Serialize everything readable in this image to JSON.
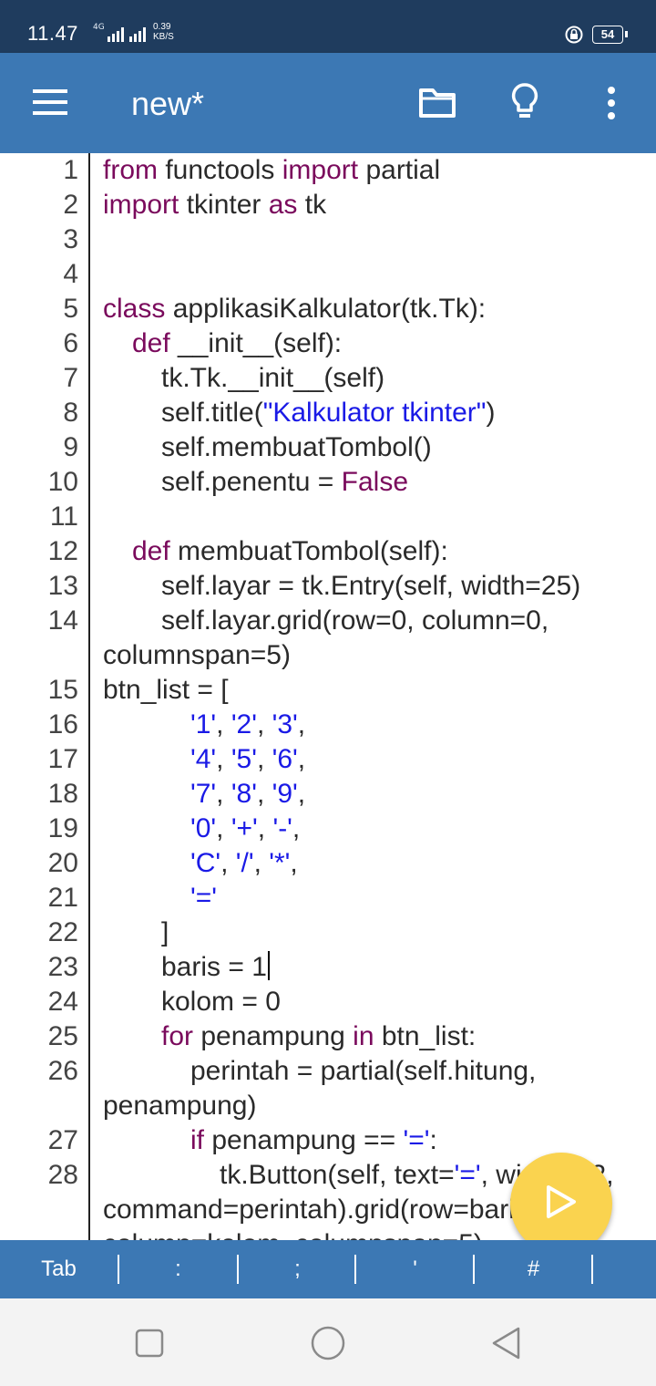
{
  "status_bar": {
    "time": "11.47",
    "network": "4G",
    "speed_value": "0.39",
    "speed_unit": "KB/S",
    "battery": "54"
  },
  "app_bar": {
    "title": "new*",
    "icons": [
      "menu-icon",
      "folder-icon",
      "lightbulb-icon",
      "more-vert-icon"
    ]
  },
  "editor": {
    "lines": [
      {
        "n": "1",
        "segs": [
          {
            "t": "from",
            "c": "kw"
          },
          {
            "t": " functools ",
            "c": ""
          },
          {
            "t": "import",
            "c": "kw"
          },
          {
            "t": " partial",
            "c": ""
          }
        ]
      },
      {
        "n": "2",
        "segs": [
          {
            "t": "import",
            "c": "kw"
          },
          {
            "t": " tkinter ",
            "c": ""
          },
          {
            "t": "as",
            "c": "kw"
          },
          {
            "t": " tk",
            "c": ""
          }
        ]
      },
      {
        "n": "3",
        "segs": []
      },
      {
        "n": "4",
        "segs": []
      },
      {
        "n": "5",
        "segs": [
          {
            "t": "class",
            "c": "kw"
          },
          {
            "t": " applikasiKalkulator(tk.Tk):",
            "c": ""
          }
        ]
      },
      {
        "n": "6",
        "indent": 1,
        "segs": [
          {
            "t": "def",
            "c": "kw"
          },
          {
            "t": " __init__(self):",
            "c": ""
          }
        ]
      },
      {
        "n": "7",
        "indent": 2,
        "segs": [
          {
            "t": "tk.Tk.__init__(self)",
            "c": ""
          }
        ]
      },
      {
        "n": "8",
        "indent": 2,
        "segs": [
          {
            "t": "self.title(",
            "c": ""
          },
          {
            "t": "\"Kalkulator tkinter\"",
            "c": "str"
          },
          {
            "t": ")",
            "c": ""
          }
        ]
      },
      {
        "n": "9",
        "indent": 2,
        "segs": [
          {
            "t": "self.membuatTombol()",
            "c": ""
          }
        ]
      },
      {
        "n": "10",
        "indent": 2,
        "segs": [
          {
            "t": "self.penentu = ",
            "c": ""
          },
          {
            "t": "False",
            "c": "kw"
          }
        ]
      },
      {
        "n": "11",
        "segs": []
      },
      {
        "n": "12",
        "indent": 1,
        "segs": [
          {
            "t": "def",
            "c": "kw"
          },
          {
            "t": " membuatTombol(self):",
            "c": ""
          }
        ]
      },
      {
        "n": "13",
        "indent": 2,
        "segs": [
          {
            "t": "self.layar = tk.Entry(self, width=25)",
            "c": ""
          }
        ]
      },
      {
        "n": "14",
        "indent": 2,
        "segs": [
          {
            "t": "self.layar.grid(row=0, column=0,",
            "c": ""
          }
        ]
      },
      {
        "n": "",
        "segs": [
          {
            "t": "columnspan=5)",
            "c": ""
          }
        ]
      },
      {
        "n": "15",
        "segs": [
          {
            "t": "btn_list = [",
            "c": ""
          }
        ]
      },
      {
        "n": "16",
        "indent": 3,
        "segs": [
          {
            "t": "'1'",
            "c": "str"
          },
          {
            "t": ", ",
            "c": ""
          },
          {
            "t": "'2'",
            "c": "str"
          },
          {
            "t": ", ",
            "c": ""
          },
          {
            "t": "'3'",
            "c": "str"
          },
          {
            "t": ",",
            "c": ""
          }
        ]
      },
      {
        "n": "17",
        "indent": 3,
        "segs": [
          {
            "t": "'4'",
            "c": "str"
          },
          {
            "t": ", ",
            "c": ""
          },
          {
            "t": "'5'",
            "c": "str"
          },
          {
            "t": ", ",
            "c": ""
          },
          {
            "t": "'6'",
            "c": "str"
          },
          {
            "t": ",",
            "c": ""
          }
        ]
      },
      {
        "n": "18",
        "indent": 3,
        "segs": [
          {
            "t": "'7'",
            "c": "str"
          },
          {
            "t": ", ",
            "c": ""
          },
          {
            "t": "'8'",
            "c": "str"
          },
          {
            "t": ", ",
            "c": ""
          },
          {
            "t": "'9'",
            "c": "str"
          },
          {
            "t": ",",
            "c": ""
          }
        ]
      },
      {
        "n": "19",
        "indent": 3,
        "segs": [
          {
            "t": "'0'",
            "c": "str"
          },
          {
            "t": ", ",
            "c": ""
          },
          {
            "t": "'+'",
            "c": "str"
          },
          {
            "t": ", ",
            "c": ""
          },
          {
            "t": "'-'",
            "c": "str"
          },
          {
            "t": ",",
            "c": ""
          }
        ]
      },
      {
        "n": "20",
        "indent": 3,
        "segs": [
          {
            "t": "'C'",
            "c": "str"
          },
          {
            "t": ", ",
            "c": ""
          },
          {
            "t": "'/'",
            "c": "str"
          },
          {
            "t": ", ",
            "c": ""
          },
          {
            "t": "'*'",
            "c": "str"
          },
          {
            "t": ",",
            "c": ""
          }
        ]
      },
      {
        "n": "21",
        "indent": 3,
        "segs": [
          {
            "t": "'='",
            "c": "str"
          }
        ]
      },
      {
        "n": "22",
        "indent": 2,
        "segs": [
          {
            "t": "]",
            "c": ""
          }
        ]
      },
      {
        "n": "23",
        "indent": 2,
        "cursor": true,
        "segs": [
          {
            "t": "baris = 1",
            "c": ""
          }
        ]
      },
      {
        "n": "24",
        "indent": 2,
        "segs": [
          {
            "t": "kolom = 0",
            "c": ""
          }
        ]
      },
      {
        "n": "25",
        "indent": 2,
        "segs": [
          {
            "t": "for",
            "c": "kw"
          },
          {
            "t": " penampung ",
            "c": ""
          },
          {
            "t": "in",
            "c": "kw"
          },
          {
            "t": " btn_list:",
            "c": ""
          }
        ]
      },
      {
        "n": "26",
        "indent": 3,
        "segs": [
          {
            "t": "perintah = partial(self.hitung,",
            "c": ""
          }
        ]
      },
      {
        "n": "",
        "segs": [
          {
            "t": "penampung)",
            "c": ""
          }
        ]
      },
      {
        "n": "27",
        "indent": 3,
        "segs": [
          {
            "t": "if",
            "c": "kw"
          },
          {
            "t": " penampung == ",
            "c": ""
          },
          {
            "t": "'='",
            "c": "str"
          },
          {
            "t": ":",
            "c": ""
          }
        ]
      },
      {
        "n": "28",
        "indent": 4,
        "segs": [
          {
            "t": "tk.Button(self, text=",
            "c": ""
          },
          {
            "t": "'='",
            "c": "str"
          },
          {
            "t": ", width=22,",
            "c": ""
          }
        ]
      },
      {
        "n": "",
        "segs": [
          {
            "t": "command=perintah).grid(row=baris,",
            "c": ""
          }
        ]
      },
      {
        "n": "",
        "segs": [
          {
            "t": "column=kolom, columnspan=5)",
            "c": ""
          }
        ]
      }
    ]
  },
  "run_button": {
    "icon": "play-icon"
  },
  "key_bar": {
    "keys": [
      "Tab",
      ":",
      ";",
      "'",
      "#",
      "("
    ]
  },
  "nav_bar": {
    "icons": [
      "recents-square-icon",
      "home-circle-icon",
      "back-triangle-icon"
    ]
  }
}
